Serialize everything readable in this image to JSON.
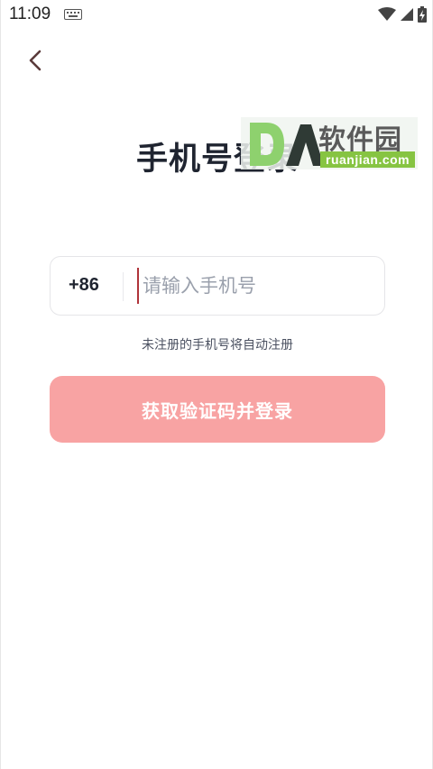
{
  "status_bar": {
    "time": "11:09",
    "icons": [
      "keyboard-icon",
      "wifi-icon",
      "signal-icon",
      "battery-charging-icon"
    ]
  },
  "header": {
    "back_icon": "chevron-left-icon",
    "title": "手机号登录"
  },
  "watermark": {
    "logo_text": "DA",
    "name": "软件园",
    "url": "ruanjian.com"
  },
  "login": {
    "country_code": "+86",
    "phone_placeholder": "请输入手机号",
    "phone_value": "",
    "hint": "未注册的手机号将自动注册",
    "submit_label": "获取验证码并登录"
  },
  "colors": {
    "title": "#1f2430",
    "button_bg": "#f8a3a3",
    "button_text": "#ffffff",
    "cursor": "#b0343a",
    "placeholder": "#9aa0ac"
  }
}
